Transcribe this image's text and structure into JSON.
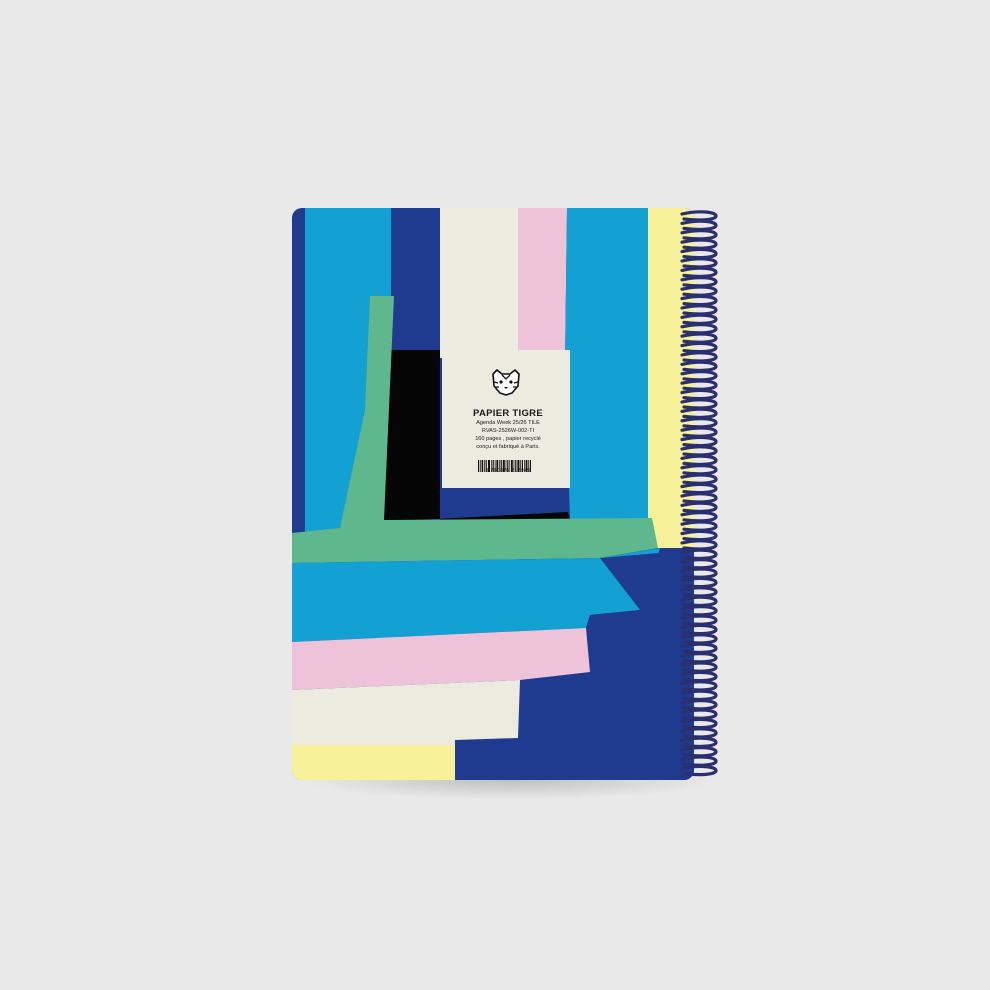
{
  "product": {
    "brand": "PAPIER TIGRE",
    "lines": [
      "Agenda Week 25/26 TILE",
      "RVAS-2526W-002-TI",
      "160 pages , papier recyclé",
      "conçu et fabriqué à Paris."
    ],
    "barcode_number": "3 700876 812949"
  },
  "colors": {
    "background": "#e9e9e9",
    "navy": "#1e3b8f",
    "cyan": "#13a0d2",
    "cream": "#ecebdf",
    "pink": "#eec3da",
    "yellow": "#f7f29a",
    "green": "#5fb78d",
    "black": "#050505",
    "coil": "#2a2f6e"
  },
  "icons": [
    "tiger-logo-icon",
    "barcode-icon",
    "spiral-binding-icon"
  ]
}
